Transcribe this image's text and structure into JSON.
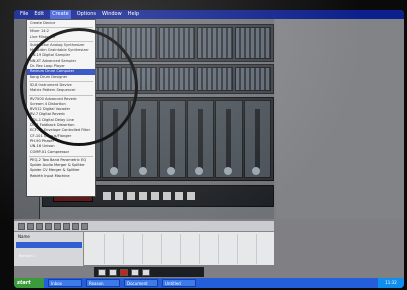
{
  "menubar": {
    "items": [
      {
        "label": "File"
      },
      {
        "label": "Edit"
      },
      {
        "label": "Create"
      },
      {
        "label": "Options"
      },
      {
        "label": "Window"
      },
      {
        "label": "Help"
      }
    ]
  },
  "create_menu": {
    "items": [
      {
        "label": "Create Device"
      },
      {
        "label": "Mixer 14:2"
      },
      {
        "label": "Line Mixer 6:2"
      },
      {
        "label": "Subtractor Analog Synthesizer"
      },
      {
        "label": "Malström Graintable Synthesizer"
      },
      {
        "label": "NN-19 Digital Sampler"
      },
      {
        "label": "NN-XT Advanced Sampler"
      },
      {
        "label": "Dr. Rex Loop Player"
      },
      {
        "label": "Redrum Drum Computer"
      },
      {
        "label": "Kong Drum Designer"
      },
      {
        "label": "ID-8 Instrument Device"
      },
      {
        "label": "Matrix Pattern Sequencer"
      },
      {
        "label": "RV7000 Advanced Reverb"
      },
      {
        "label": "Scream 4 Distortion"
      },
      {
        "label": "BV512 Digital Vocoder"
      },
      {
        "label": "RV-7 Digital Reverb"
      },
      {
        "label": "DDL-1 Digital Delay Line"
      },
      {
        "label": "D-11 Foldback Distortion"
      },
      {
        "label": "ECF-42 Envelope Controlled Filter"
      },
      {
        "label": "CF-101 Chorus/Flanger"
      },
      {
        "label": "PH-90 Phaser"
      },
      {
        "label": "UN-16 Unison"
      },
      {
        "label": "COMP-01 Compressor"
      },
      {
        "label": "PEQ-2 Two Band Parametric EQ"
      },
      {
        "label": "Spider Audio Merger & Splitter"
      },
      {
        "label": "Spider CV Merger & Splitter"
      },
      {
        "label": "Rebirth Input Machine"
      }
    ],
    "selected_index": 8
  },
  "tracks": {
    "header_label": "Name",
    "rows": [
      {
        "label": "Redrum 1"
      }
    ]
  },
  "taskbar": {
    "start_label": "start",
    "tasks": [
      {
        "label": "Inbox"
      },
      {
        "label": "Reason"
      },
      {
        "label": "Document"
      },
      {
        "label": "Untitled"
      }
    ],
    "clock": "11:32"
  }
}
